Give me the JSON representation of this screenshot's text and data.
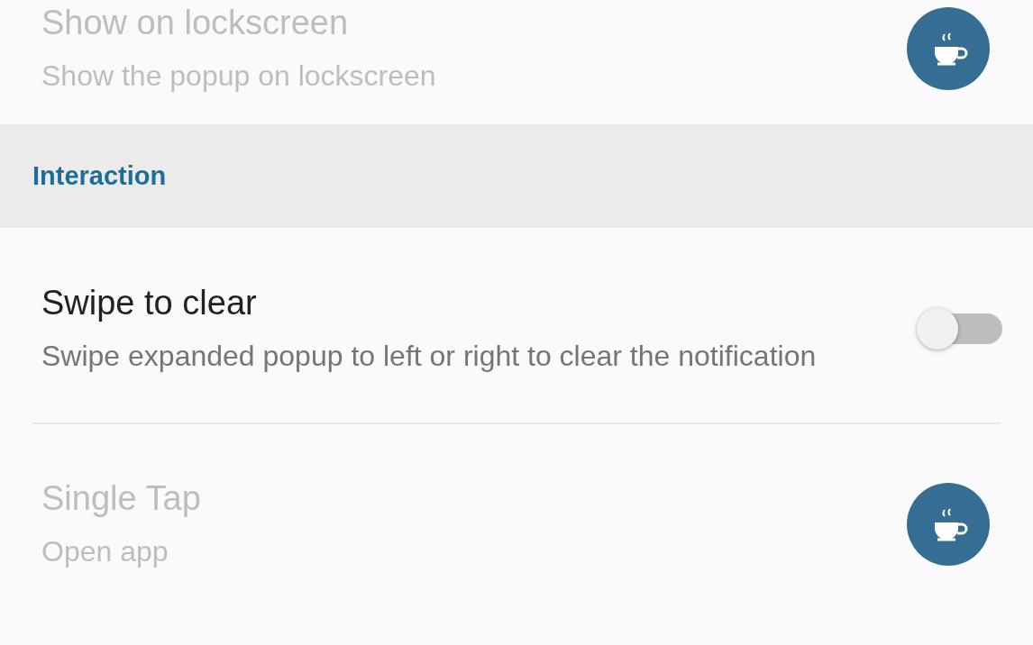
{
  "sections": [
    {
      "items": [
        {
          "kind": "icon",
          "title": "Show on lockscreen",
          "subtitle": "Show the popup on lockscreen",
          "disabled": true
        }
      ]
    },
    {
      "header": "Interaction",
      "items": [
        {
          "kind": "switch",
          "title": "Swipe to clear",
          "subtitle": "Swipe expanded popup to left or right to clear the notification",
          "disabled": false,
          "on": false
        },
        {
          "kind": "icon",
          "title": "Single Tap",
          "subtitle": "Open app",
          "disabled": true
        }
      ]
    }
  ]
}
